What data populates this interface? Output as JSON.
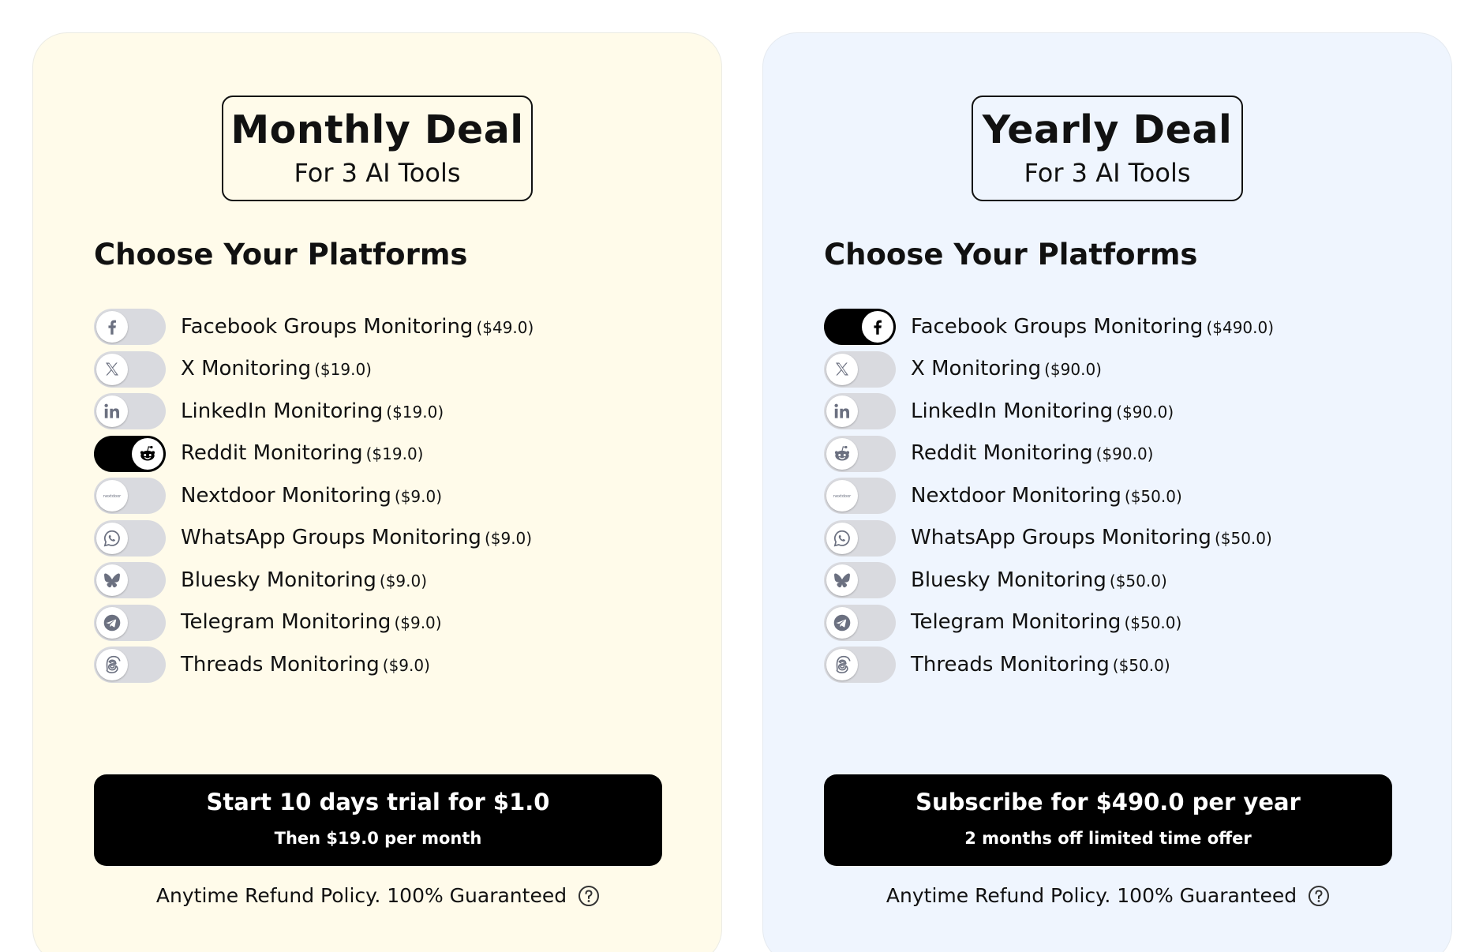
{
  "monthly": {
    "title": "Monthly Deal",
    "subtitle": "For 3 AI Tools",
    "section_title": "Choose Your Platforms",
    "platforms": [
      {
        "name": "Facebook Groups Monitoring",
        "price": "($49.0)",
        "icon": "facebook-icon",
        "enabled": false
      },
      {
        "name": "X Monitoring",
        "price": "($19.0)",
        "icon": "x-icon",
        "enabled": false
      },
      {
        "name": "LinkedIn Monitoring",
        "price": "($19.0)",
        "icon": "linkedin-icon",
        "enabled": false
      },
      {
        "name": "Reddit Monitoring",
        "price": "($19.0)",
        "icon": "reddit-icon",
        "enabled": true
      },
      {
        "name": "Nextdoor Monitoring",
        "price": "($9.0)",
        "icon": "nextdoor-icon",
        "enabled": false
      },
      {
        "name": "WhatsApp Groups Monitoring",
        "price": "($9.0)",
        "icon": "whatsapp-icon",
        "enabled": false
      },
      {
        "name": "Bluesky Monitoring",
        "price": "($9.0)",
        "icon": "bluesky-icon",
        "enabled": false
      },
      {
        "name": "Telegram Monitoring",
        "price": "($9.0)",
        "icon": "telegram-icon",
        "enabled": false
      },
      {
        "name": "Threads Monitoring",
        "price": "($9.0)",
        "icon": "threads-icon",
        "enabled": false
      }
    ],
    "cta_main": "Start 10 days trial for $1.0",
    "cta_sub": "Then $19.0 per month",
    "refund_text": "Anytime Refund Policy. 100% Guaranteed"
  },
  "yearly": {
    "title": "Yearly Deal",
    "subtitle": "For 3 AI Tools",
    "section_title": "Choose Your Platforms",
    "platforms": [
      {
        "name": "Facebook Groups Monitoring",
        "price": "($490.0)",
        "icon": "facebook-icon",
        "enabled": true
      },
      {
        "name": "X Monitoring",
        "price": "($90.0)",
        "icon": "x-icon",
        "enabled": false
      },
      {
        "name": "LinkedIn Monitoring",
        "price": "($90.0)",
        "icon": "linkedin-icon",
        "enabled": false
      },
      {
        "name": "Reddit Monitoring",
        "price": "($90.0)",
        "icon": "reddit-icon",
        "enabled": false
      },
      {
        "name": "Nextdoor Monitoring",
        "price": "($50.0)",
        "icon": "nextdoor-icon",
        "enabled": false
      },
      {
        "name": "WhatsApp Groups Monitoring",
        "price": "($50.0)",
        "icon": "whatsapp-icon",
        "enabled": false
      },
      {
        "name": "Bluesky Monitoring",
        "price": "($50.0)",
        "icon": "bluesky-icon",
        "enabled": false
      },
      {
        "name": "Telegram Monitoring",
        "price": "($50.0)",
        "icon": "telegram-icon",
        "enabled": false
      },
      {
        "name": "Threads Monitoring",
        "price": "($50.0)",
        "icon": "threads-icon",
        "enabled": false
      }
    ],
    "cta_main": "Subscribe for $490.0 per year",
    "cta_sub": "2 months off limited time offer",
    "refund_text": "Anytime Refund Policy. 100% Guaranteed"
  },
  "colors": {
    "monthly_card_bg": "#fffbea",
    "yearly_card_bg": "#eff5fe",
    "toggle_off": "#d9dadf",
    "toggle_on": "#000000",
    "icon_gray": "#6b7080"
  }
}
